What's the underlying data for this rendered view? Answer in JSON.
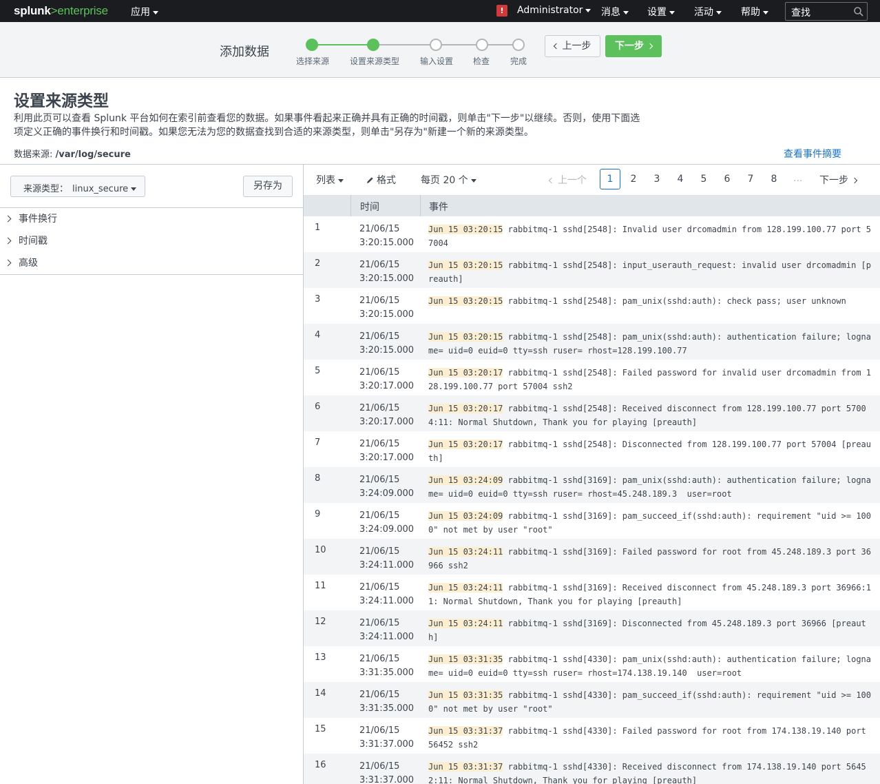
{
  "nav": {
    "logo_brand": "splunk",
    "logo_gt": ">",
    "logo_product": "enterprise",
    "apps": "应用",
    "alert": "!",
    "user": "Administrator",
    "messages": "消息",
    "settings": "设置",
    "activity": "活动",
    "help": "帮助",
    "search": "查找"
  },
  "wizard": {
    "title": "添加数据",
    "steps": [
      "选择来源",
      "设置来源类型",
      "输入设置",
      "检查",
      "完成"
    ],
    "current_step": 2,
    "prev_label": "上一步",
    "next_label": "下一步",
    "colors": {
      "done": "#5cc05c",
      "todo": "#b5b5b5"
    }
  },
  "header": {
    "title": "设置来源类型",
    "description": "利用此页可以查看 Splunk 平台如何在索引前查看您的数据。如果事件看起来正确并具有正确的时间戳，则单击\"下一步\"以继续。否则，使用下面选项定义正确的事件换行和时间戳。如果您无法为您的数据查找到合适的来源类型，则单击\"另存为\"新建一个新的来源类型。",
    "source_label": "数据来源: ",
    "source_value": "/var/log/secure",
    "summary_link": "查看事件摘要"
  },
  "left": {
    "sourcetype_label": "来源类型：",
    "sourcetype_value": "linux_secure",
    "save_as": "另存为",
    "sections": [
      "事件换行",
      "时间戳",
      "高级"
    ]
  },
  "toolbar": {
    "list": "列表",
    "format": "格式",
    "per_page": "每页 20 个",
    "prev": "上一个",
    "pages": [
      "1",
      "2",
      "3",
      "4",
      "5",
      "6",
      "7",
      "8"
    ],
    "current_page": "1",
    "ellipsis": "...",
    "next": "下一步"
  },
  "table": {
    "col_time": "时间",
    "col_event": "事件",
    "rows": [
      {
        "n": "1",
        "date": "21/06/15",
        "time": "3:20:15.000",
        "ts": "Jun 15 03:20:15",
        "msg": " rabbitmq-1 sshd[2548]: Invalid user drcomadmin from 128.199.100.77 port 57004"
      },
      {
        "n": "2",
        "date": "21/06/15",
        "time": "3:20:15.000",
        "ts": "Jun 15 03:20:15",
        "msg": " rabbitmq-1 sshd[2548]: input_userauth_request: invalid user drcomadmin [preauth]"
      },
      {
        "n": "3",
        "date": "21/06/15",
        "time": "3:20:15.000",
        "ts": "Jun 15 03:20:15",
        "msg": " rabbitmq-1 sshd[2548]: pam_unix(sshd:auth): check pass; user unknown"
      },
      {
        "n": "4",
        "date": "21/06/15",
        "time": "3:20:15.000",
        "ts": "Jun 15 03:20:15",
        "msg": " rabbitmq-1 sshd[2548]: pam_unix(sshd:auth): authentication failure; logname= uid=0 euid=0 tty=ssh ruser= rhost=128.199.100.77"
      },
      {
        "n": "5",
        "date": "21/06/15",
        "time": "3:20:17.000",
        "ts": "Jun 15 03:20:17",
        "msg": " rabbitmq-1 sshd[2548]: Failed password for invalid user drcomadmin from 128.199.100.77 port 57004 ssh2"
      },
      {
        "n": "6",
        "date": "21/06/15",
        "time": "3:20:17.000",
        "ts": "Jun 15 03:20:17",
        "msg": " rabbitmq-1 sshd[2548]: Received disconnect from 128.199.100.77 port 57004:11: Normal Shutdown, Thank you for playing [preauth]"
      },
      {
        "n": "7",
        "date": "21/06/15",
        "time": "3:20:17.000",
        "ts": "Jun 15 03:20:17",
        "msg": " rabbitmq-1 sshd[2548]: Disconnected from 128.199.100.77 port 57004 [preauth]"
      },
      {
        "n": "8",
        "date": "21/06/15",
        "time": "3:24:09.000",
        "ts": "Jun 15 03:24:09",
        "msg": " rabbitmq-1 sshd[3169]: pam_unix(sshd:auth): authentication failure; logname= uid=0 euid=0 tty=ssh ruser= rhost=45.248.189.3  user=root"
      },
      {
        "n": "9",
        "date": "21/06/15",
        "time": "3:24:09.000",
        "ts": "Jun 15 03:24:09",
        "msg": " rabbitmq-1 sshd[3169]: pam_succeed_if(sshd:auth): requirement \"uid >= 1000\" not met by user \"root\""
      },
      {
        "n": "10",
        "date": "21/06/15",
        "time": "3:24:11.000",
        "ts": "Jun 15 03:24:11",
        "msg": " rabbitmq-1 sshd[3169]: Failed password for root from 45.248.189.3 port 36966 ssh2"
      },
      {
        "n": "11",
        "date": "21/06/15",
        "time": "3:24:11.000",
        "ts": "Jun 15 03:24:11",
        "msg": " rabbitmq-1 sshd[3169]: Received disconnect from 45.248.189.3 port 36966:11: Normal Shutdown, Thank you for playing [preauth]"
      },
      {
        "n": "12",
        "date": "21/06/15",
        "time": "3:24:11.000",
        "ts": "Jun 15 03:24:11",
        "msg": " rabbitmq-1 sshd[3169]: Disconnected from 45.248.189.3 port 36966 [preauth]"
      },
      {
        "n": "13",
        "date": "21/06/15",
        "time": "3:31:35.000",
        "ts": "Jun 15 03:31:35",
        "msg": " rabbitmq-1 sshd[4330]: pam_unix(sshd:auth): authentication failure; logname= uid=0 euid=0 tty=ssh ruser= rhost=174.138.19.140  user=root"
      },
      {
        "n": "14",
        "date": "21/06/15",
        "time": "3:31:35.000",
        "ts": "Jun 15 03:31:35",
        "msg": " rabbitmq-1 sshd[4330]: pam_succeed_if(sshd:auth): requirement \"uid >= 1000\" not met by user \"root\""
      },
      {
        "n": "15",
        "date": "21/06/15",
        "time": "3:31:37.000",
        "ts": "Jun 15 03:31:37",
        "msg": " rabbitmq-1 sshd[4330]: Failed password for root from 174.138.19.140 port 56452 ssh2"
      },
      {
        "n": "16",
        "date": "21/06/15",
        "time": "3:31:37.000",
        "ts": "Jun 15 03:31:37",
        "msg": " rabbitmq-1 sshd[4330]: Received disconnect from 174.138.19.140 port 56452:11: Normal Shutdown, Thank you for playing [preauth]"
      }
    ]
  }
}
